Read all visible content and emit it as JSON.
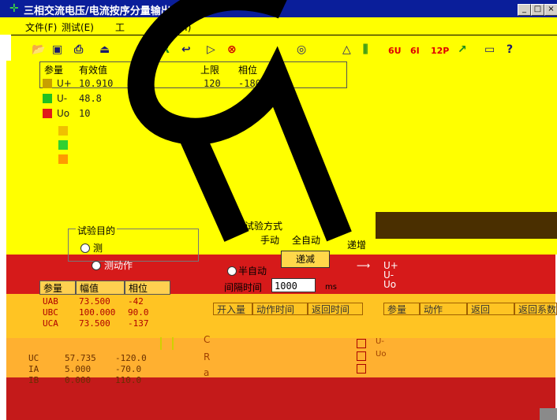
{
  "window": {
    "title": "三相交流电压/电流按序分量输出",
    "min_label": "_",
    "max_label": "□",
    "close_label": "×"
  },
  "menu": {
    "items": [
      {
        "label": "文件(F)"
      },
      {
        "label": "测试(E)"
      },
      {
        "label": "工"
      },
      {
        "label": "帮助(H)"
      }
    ]
  },
  "toolbar": {
    "labels": [
      "6U",
      "6I",
      "12P"
    ]
  },
  "grid": {
    "headers": [
      "参量",
      "有效值",
      "上限",
      "相位"
    ],
    "rows": [
      {
        "name": "U+",
        "value": "10.910",
        "upper": "120",
        "phase": "-180.0"
      },
      {
        "name": "U-",
        "value": "48.8",
        "upper": "",
        "phase": ""
      },
      {
        "name": "Uo",
        "value": "10",
        "upper": "",
        "phase": ""
      }
    ]
  },
  "test_purpose": {
    "title": "试验目的",
    "option1": "测",
    "option2": "测动作"
  },
  "test_mode": {
    "title": "试验方式",
    "manual": "手动",
    "auto": "全自动",
    "semi_auto": "半自动",
    "increase": "递增",
    "decrease": "递减",
    "interval_label": "间隔时间",
    "interval_value": "1000",
    "interval_unit": "ms"
  },
  "output_table": {
    "headers": [
      "参量",
      "幅值",
      "相位"
    ],
    "rows": [
      {
        "name": "UAB",
        "amp": "73.500",
        "phase": "-42"
      },
      {
        "name": "UBC",
        "amp": "100.000",
        "phase": "90.0"
      },
      {
        "name": "UCA",
        "amp": "73.500",
        "phase": "-137"
      },
      {
        "name": "UC",
        "amp": "57.735",
        "phase": "-120.0"
      },
      {
        "name": "IA",
        "amp": "5.000",
        "phase": "-70.0"
      },
      {
        "name": "IB",
        "amp": "0.000",
        "phase": "110.0"
      }
    ]
  },
  "result_headers": {
    "left": [
      "开入量",
      "动作时间",
      "返回时间"
    ],
    "right": [
      "参量",
      "动作",
      "返回",
      "返回系数"
    ]
  },
  "vector_labels": [
    "U+",
    "U-",
    "Uo"
  ],
  "legend_labels": [
    "U-",
    "Uo"
  ],
  "side_letters": [
    "C",
    "R",
    "a"
  ],
  "colors": {
    "title_bar": "#0a1e9a",
    "yellow": "#ffff00",
    "red": "#d61a1a",
    "orange": "#ffc423"
  }
}
